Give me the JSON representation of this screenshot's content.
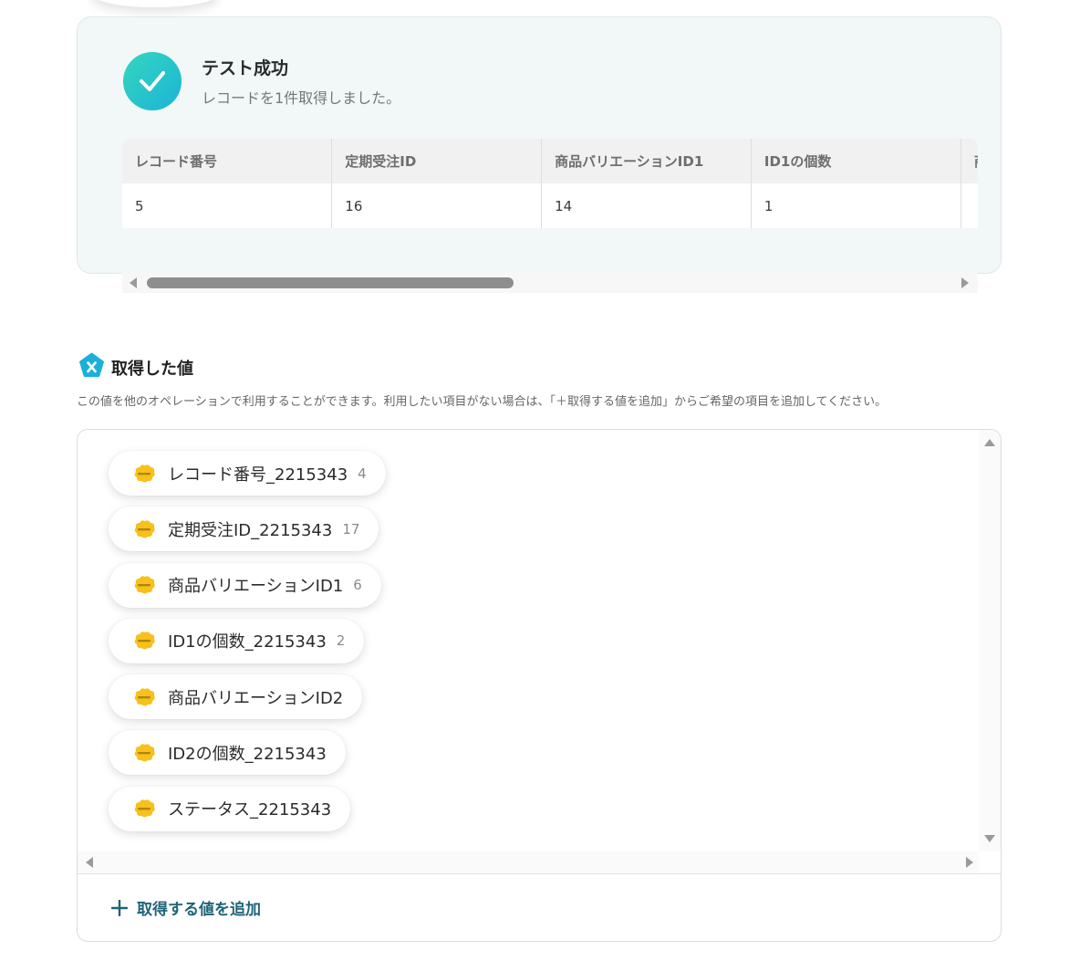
{
  "result": {
    "title": "テスト成功",
    "message": "レコードを1件取得しました。",
    "table": {
      "headers": [
        "レコード番号",
        "定期受注ID",
        "商品バリエーションID1",
        "ID1の個数",
        "商"
      ],
      "rows": [
        [
          "5",
          "16",
          "14",
          "1",
          ""
        ]
      ]
    }
  },
  "acquired": {
    "title": "取得した値",
    "description": "この値を他のオペレーションで利用することができます。利用したい項目がない場合は、「＋取得する値を追加」からご希望の項目を追加してください。",
    "items": [
      {
        "label": "レコード番号_2215343",
        "value": "4"
      },
      {
        "label": "定期受注ID_2215343",
        "value": "17"
      },
      {
        "label": "商品バリエーションID1",
        "value": "6"
      },
      {
        "label": "ID1の個数_2215343",
        "value": "2"
      },
      {
        "label": "商品バリエーションID2",
        "value": ""
      },
      {
        "label": "ID2の個数_2215343",
        "value": ""
      },
      {
        "label": "ステータス_2215343",
        "value": ""
      }
    ],
    "item_icon": "kintone-icon",
    "add_button_label": "取得する値を追加"
  },
  "colors": {
    "success_gradient_start": "#35d6bf",
    "success_gradient_end": "#1bb4d6",
    "card_background": "#f1f8f7",
    "accent_text": "#1f6478",
    "kintone_yellow": "#f7c11c"
  }
}
